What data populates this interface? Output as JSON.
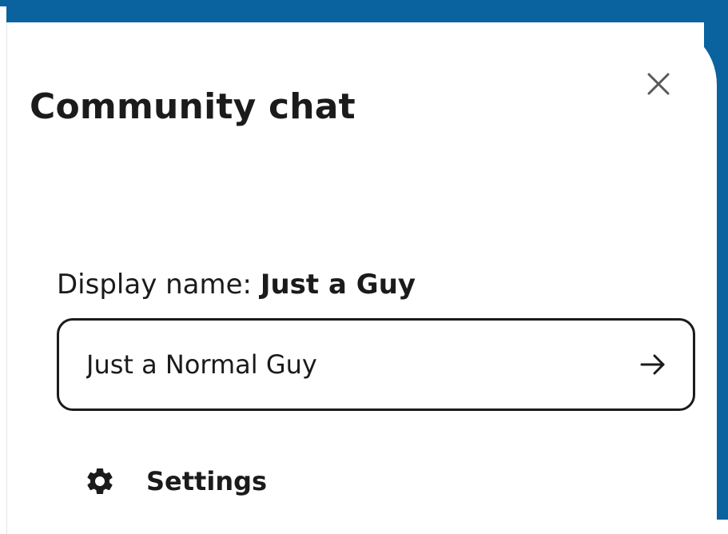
{
  "colors": {
    "accent_band": "#0a629f",
    "panel_background": "#ffffff",
    "text": "#1b1b1b"
  },
  "panel": {
    "title": "Community chat",
    "close_icon": "close-icon"
  },
  "profile": {
    "display_name_label": "Display name:",
    "display_name_value": "Just a Guy",
    "name_input_value": "Just a Normal Guy",
    "submit_icon": "arrow-right-icon"
  },
  "menu": {
    "settings_label": "Settings",
    "settings_icon": "gear-icon"
  }
}
